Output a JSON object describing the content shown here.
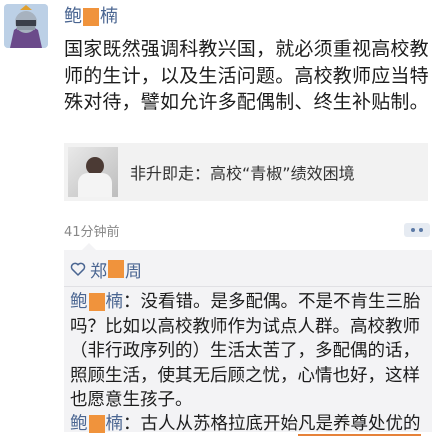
{
  "post": {
    "author_prefix": "鲍",
    "author_suffix": "楠",
    "text": "国家既然强调科教兴国，就必须重视高校教师的生计，以及生活问题。高校教师应当特殊对待，譬如允许多配偶制、终生补贴制。",
    "share_title": "非升即走：高校“青椒”绩效困境",
    "time": "41分钟前"
  },
  "likes": {
    "name_prefix": "郑",
    "name_suffix": "周"
  },
  "comments": [
    {
      "author_prefix": "鲍",
      "author_suffix": "楠",
      "sep": "：",
      "text": "没看错。是多配偶。不是不肯生三胎吗？比如以高校教师作为试点人群。高校教师（非行政序列的）生活太苦了，多配偶的话，照顾生活，使其无后顾之忧，心情也好，这样也愿意生孩子。"
    },
    {
      "author_prefix": "鲍",
      "author_suffix": "楠",
      "sep": "：",
      "text_a": "古人从苏格拉底开始",
      "text_b": "凡是养尊处优的"
    }
  ],
  "colors": {
    "link": "#4a6591",
    "redaction": "#f0933c",
    "comment_bg": "#f3f3f5"
  }
}
